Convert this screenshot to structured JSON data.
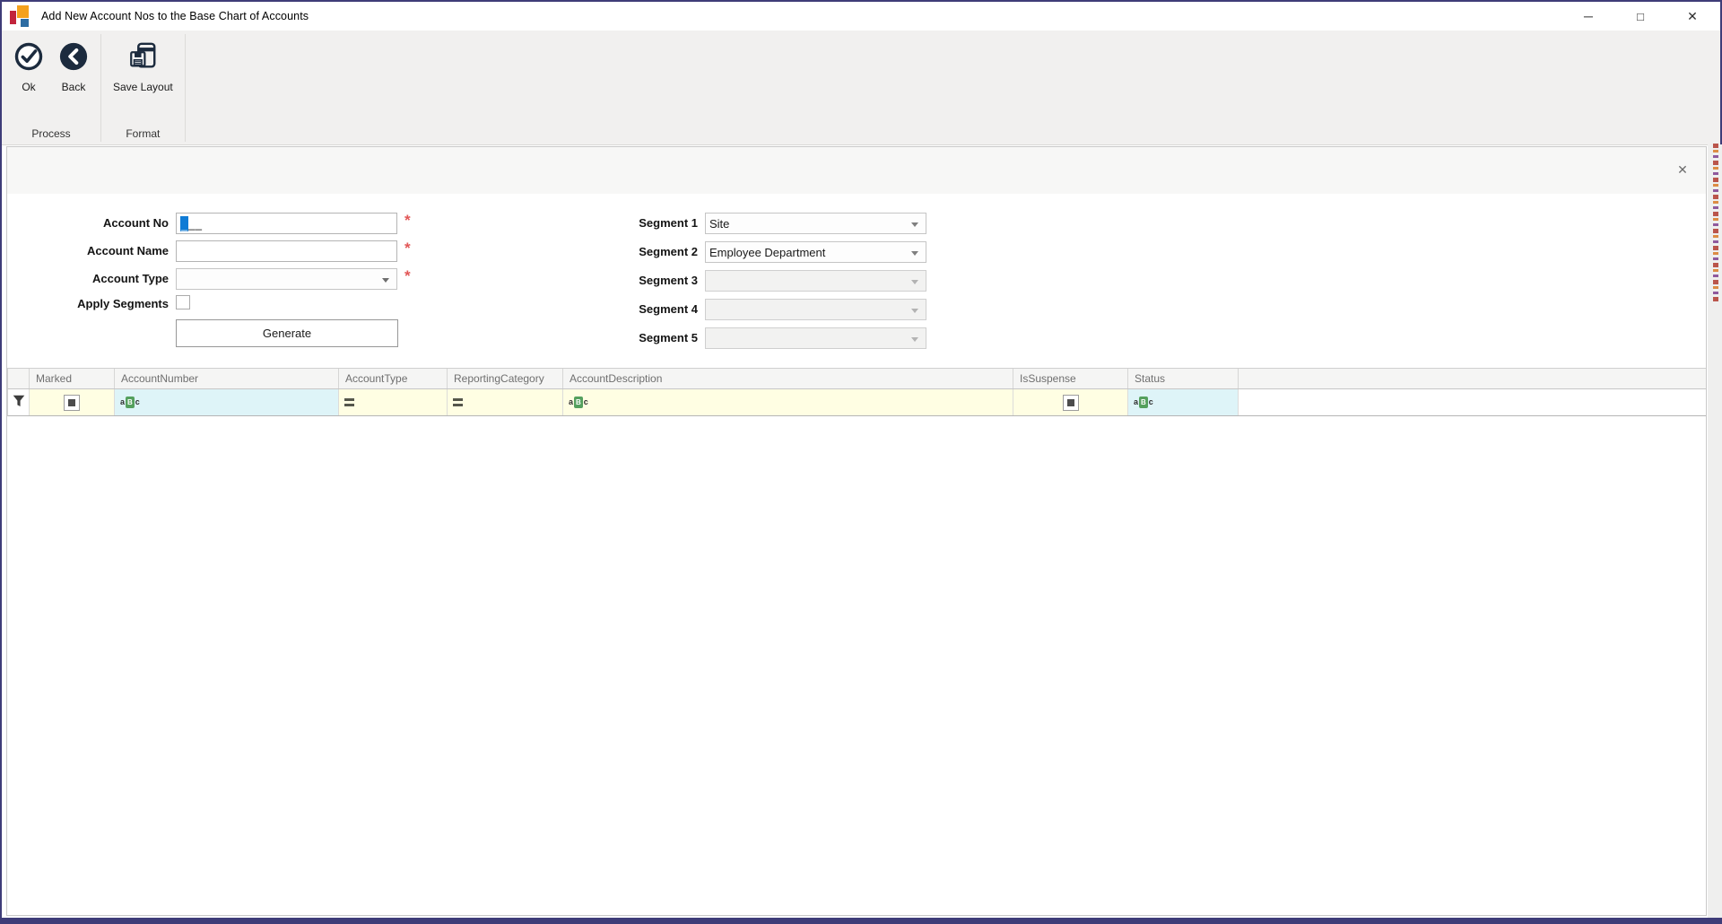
{
  "window": {
    "title": "Add New Account Nos to the Base Chart of Accounts",
    "minimize_glyph": "─",
    "maximize_glyph": "□",
    "close_glyph": "✕"
  },
  "ribbon": {
    "buttons": [
      {
        "label": "Ok"
      },
      {
        "label": "Back"
      },
      {
        "label": "Save Layout"
      }
    ],
    "groups": [
      {
        "label": "Process"
      },
      {
        "label": "Format"
      }
    ]
  },
  "panel": {
    "close_glyph": "✕"
  },
  "form": {
    "required_marker": "*",
    "account_no": {
      "label": "Account No",
      "value": "",
      "mask_selected": "_",
      "mask_rest": "__"
    },
    "account_name": {
      "label": "Account Name",
      "value": ""
    },
    "account_type": {
      "label": "Account Type",
      "value": ""
    },
    "apply_segments": {
      "label": "Apply Segments",
      "checked": false
    },
    "generate_label": "Generate",
    "segments": [
      {
        "label": "Segment 1",
        "value": "Site"
      },
      {
        "label": "Segment 2",
        "value": "Employee Department"
      },
      {
        "label": "Segment 3",
        "value": ""
      },
      {
        "label": "Segment 4",
        "value": ""
      },
      {
        "label": "Segment 5",
        "value": ""
      }
    ]
  },
  "grid": {
    "columns": [
      {
        "name": "Marked",
        "filter": "checkbox"
      },
      {
        "name": "AccountNumber",
        "filter": "abc"
      },
      {
        "name": "AccountType",
        "filter": "equals"
      },
      {
        "name": "ReportingCategory",
        "filter": "equals"
      },
      {
        "name": "AccountDescription",
        "filter": "abc"
      },
      {
        "name": "IsSuspense",
        "filter": "checkbox"
      },
      {
        "name": "Status",
        "filter": "abc"
      }
    ],
    "abc_icon": {
      "a": "a",
      "b": "B",
      "c": "c"
    }
  },
  "colors": {
    "window_border": "#3e3c78",
    "icon_navy": "#1c2b3e",
    "filter_yellow": "#fffee3",
    "filter_cyan": "#def4f8",
    "badge_green": "#55a05e",
    "required_red": "#e25757",
    "selection_blue": "#0f7bd5",
    "artifact_red": "#b03a2e",
    "artifact_orange": "#d97b26"
  }
}
